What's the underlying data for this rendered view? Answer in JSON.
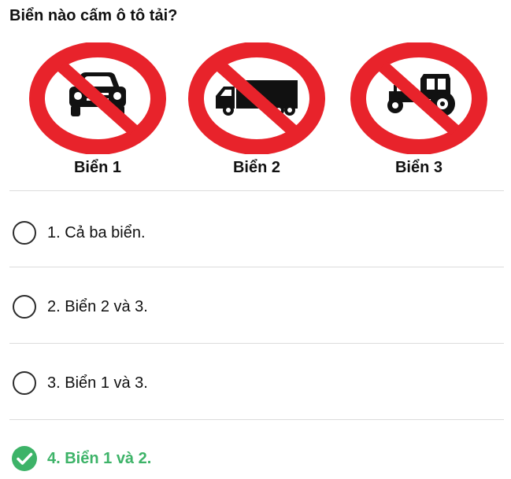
{
  "question": "Biển nào cấm ô tô tải?",
  "signs": [
    {
      "label": "Biển 1",
      "icon": "car-icon"
    },
    {
      "label": "Biển 2",
      "icon": "truck-icon"
    },
    {
      "label": "Biển 3",
      "icon": "tractor-icon"
    }
  ],
  "options": [
    {
      "label": "1. Cả ba biển.",
      "state": "unselected"
    },
    {
      "label": "2. Biển 2 và 3.",
      "state": "unselected"
    },
    {
      "label": "3. Biển 1 và 3.",
      "state": "unselected"
    },
    {
      "label": "4. Biển 1 và 2.",
      "state": "correct"
    }
  ],
  "colors": {
    "sign_red": "#e8232b",
    "correct_green": "#3db368",
    "divider": "#dcdcdc"
  }
}
